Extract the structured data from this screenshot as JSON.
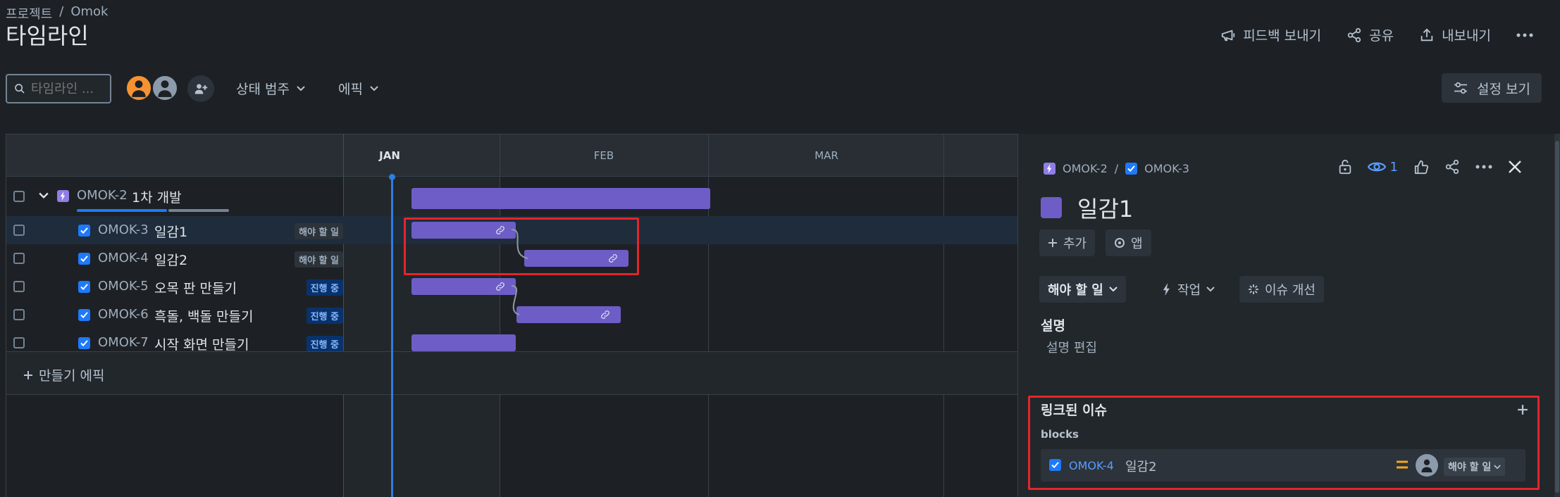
{
  "breadcrumb": {
    "project": "프로젝트",
    "separator": "/",
    "name": "Omok"
  },
  "page_title": "타임라인",
  "header_actions": {
    "feedback": "피드백 보내기",
    "share": "공유",
    "export": "내보내기"
  },
  "toolbar": {
    "search_placeholder": "타임라인 ...",
    "status_filter": "상태 범주",
    "epic_filter": "에픽",
    "view_settings": "설정 보기"
  },
  "timeline": {
    "months": [
      "JAN",
      "FEB",
      "MAR"
    ],
    "epic": {
      "key": "OMOK-2",
      "summary": "1차 개발"
    },
    "rows": [
      {
        "key": "OMOK-3",
        "summary": "일감1",
        "status": "해야 할 일"
      },
      {
        "key": "OMOK-4",
        "summary": "일감2",
        "status": "해야 할 일"
      },
      {
        "key": "OMOK-5",
        "summary": "오목 판 만들기",
        "status": "진행 중"
      },
      {
        "key": "OMOK-6",
        "summary": "흑돌, 백돌 만들기",
        "status": "진행 중"
      },
      {
        "key": "OMOK-7",
        "summary": "시작 화면 만들기",
        "status": "진행 중"
      }
    ],
    "create_epic": "만들기 에픽"
  },
  "panel": {
    "breadcrumb_parent": "OMOK-2",
    "breadcrumb_separator": "/",
    "breadcrumb_current": "OMOK-3",
    "watch_count": "1",
    "title": "일감1",
    "add_button": "추가",
    "apps_button": "앱",
    "status_button": "해야 할 일",
    "action_button": "작업",
    "improve_button": "이슈 개선",
    "description_label": "설명",
    "description_edit": "설명 편집",
    "linked_issues_label": "링크된 이슈",
    "link_type": "blocks",
    "linked_issue": {
      "key": "OMOK-4",
      "summary": "일감2",
      "status": "해야 할 일"
    }
  },
  "colors": {
    "bar": "#6e5dc6",
    "today": "#2f7de1",
    "highlight": "#e2262b",
    "priority": "#f5a623"
  }
}
